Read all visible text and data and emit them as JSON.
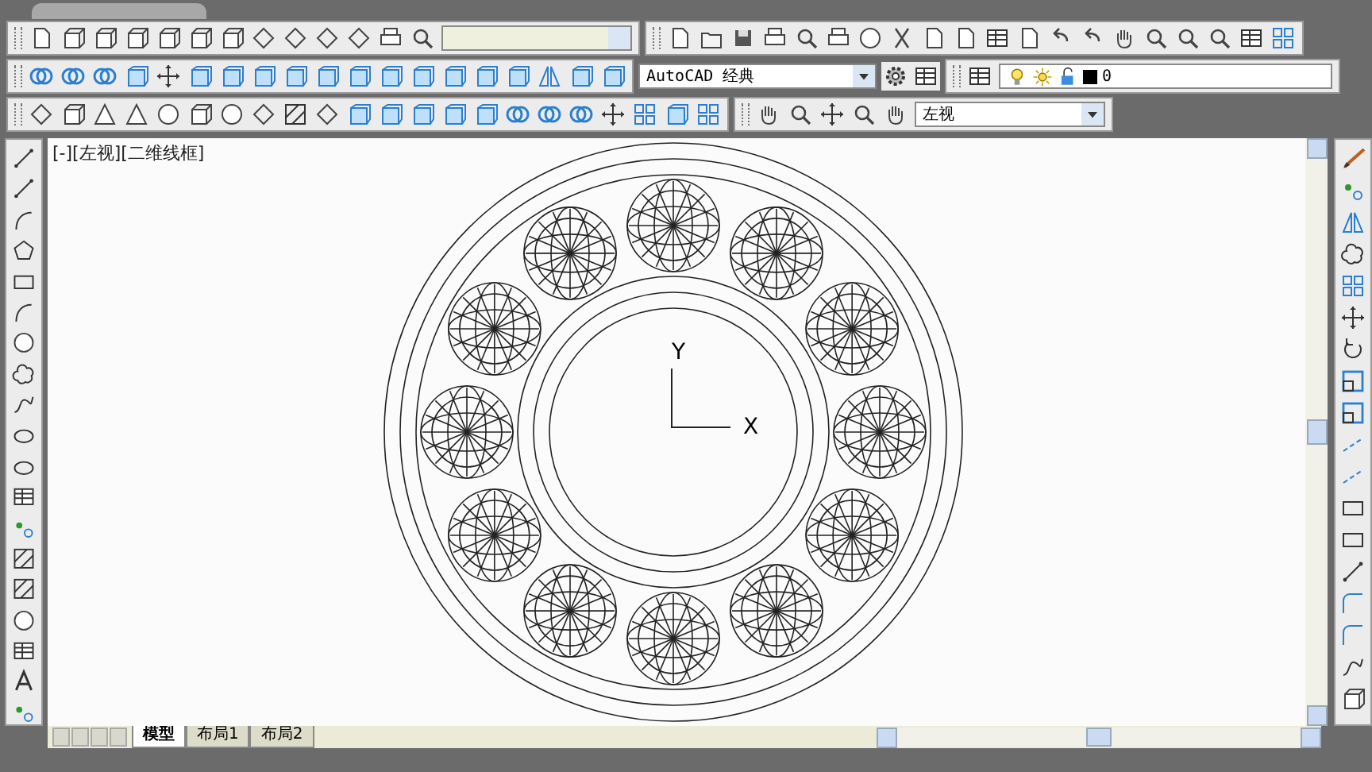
{
  "workspace": {
    "value": "AutoCAD 经典"
  },
  "layer": {
    "name": "0",
    "color": "#000000"
  },
  "view": {
    "value": "左视"
  },
  "viewport": {
    "label": "[-][左视][二维线框]"
  },
  "ucs": {
    "y_label": "Y",
    "x_label": "X"
  },
  "layout_tabs": [
    {
      "label": "模型",
      "selected": true
    },
    {
      "label": "布局1",
      "selected": false
    },
    {
      "label": "布局2",
      "selected": false
    }
  ]
}
